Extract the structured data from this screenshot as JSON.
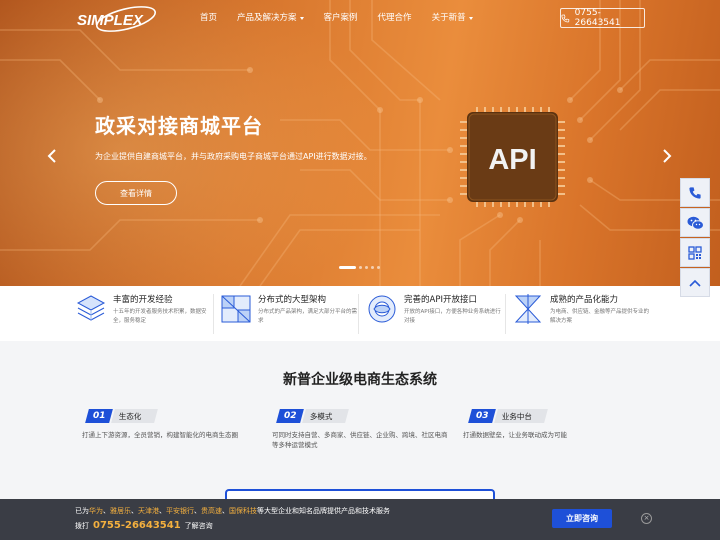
{
  "brand": {
    "logo_text": "SIMPLEX"
  },
  "nav": {
    "items": [
      {
        "label": "首页",
        "has_caret": false
      },
      {
        "label": "产品及解决方案",
        "has_caret": true
      },
      {
        "label": "客户案例",
        "has_caret": false
      },
      {
        "label": "代理合作",
        "has_caret": false
      },
      {
        "label": "关于新普",
        "has_caret": true
      }
    ],
    "phone": "0755-26643541"
  },
  "hero": {
    "title": "政采对接商城平台",
    "subtitle": "为企业提供自建商城平台，并与政府采购电子商城平台通过API进行数据对接。",
    "button": "查看详情",
    "chip_text": "API",
    "slide_count": 5,
    "active_slide": 1
  },
  "features": [
    {
      "title": "丰富的开发经验",
      "desc": "十五年的开发者服务技术积累，数据安全，服务稳定"
    },
    {
      "title": "分布式的大型架构",
      "desc": "分布式的产品架构，满足大部分平台的需求"
    },
    {
      "title": "完善的API开放接口",
      "desc": "开放的API接口，方便各种业务系统进行对接"
    },
    {
      "title": "成熟的产品化能力",
      "desc": "为电商、供应链、金融等产品提供专业的解决方案"
    }
  ],
  "section": {
    "title": "新普企业级电商生态系统",
    "columns": [
      {
        "num": "01",
        "label": "生态化",
        "desc": "打通上下游资源，全员营销，构建智能化的电商生态圈"
      },
      {
        "num": "02",
        "label": "多模式",
        "desc": "可同时支持自营、多商家、供应链、企业购、跨境、社区电商等多种运营模式"
      },
      {
        "num": "03",
        "label": "业务中台",
        "desc": "打通数据壁垒，让业务联动成为可能"
      }
    ]
  },
  "bottom_bar": {
    "prefix": "已为",
    "partners": [
      "华为",
      "雅居乐",
      "天津港",
      "平安银行",
      "贵高速",
      "国保科技"
    ],
    "suffix": "等大型企业和知名品牌提供产品和技术服务",
    "line2_prefix": "拨打",
    "phone": "0755-26643541",
    "line2_suffix": "了解咨询",
    "consult_button": "立即咨询",
    "close": "×"
  },
  "colors": {
    "accent_blue": "#1e50d8",
    "hero_orange": "#e0802f",
    "highlight": "#f4b03e",
    "bottom_bar_bg": "#3a3d45"
  },
  "icons": {
    "sidebar": [
      "phone-icon",
      "wechat-icon",
      "qrcode-icon",
      "chevron-up-icon"
    ]
  }
}
